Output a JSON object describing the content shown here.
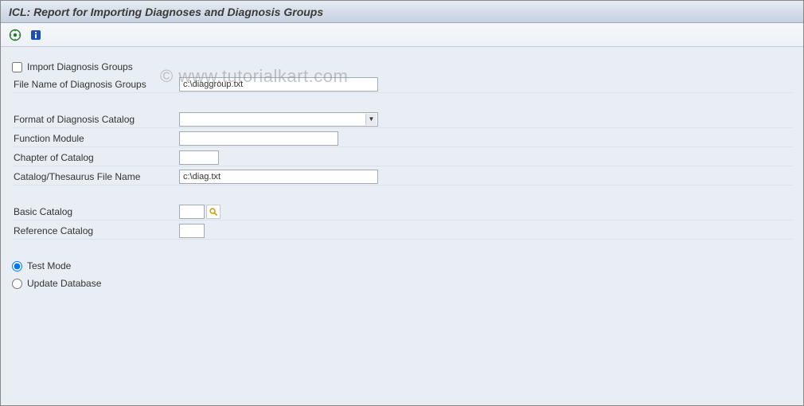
{
  "header": {
    "title": "ICL: Report for Importing Diagnoses and Diagnosis Groups"
  },
  "toolbar": {
    "execute_icon": "execute",
    "info_icon": "info"
  },
  "form": {
    "import_groups": {
      "label": "Import Diagnosis Groups",
      "checked": false
    },
    "file_name_groups": {
      "label": "File Name of Diagnosis Groups",
      "value": "c:\\diaggroup.txt"
    },
    "format_catalog": {
      "label": "Format of Diagnosis Catalog",
      "value": ""
    },
    "function_module": {
      "label": "Function Module",
      "value": ""
    },
    "chapter_catalog": {
      "label": "Chapter of Catalog",
      "value": ""
    },
    "catalog_file_name": {
      "label": "Catalog/Thesaurus File Name",
      "value": "c:\\diag.txt"
    },
    "basic_catalog": {
      "label": "Basic Catalog",
      "value": ""
    },
    "reference_catalog": {
      "label": "Reference Catalog",
      "value": ""
    },
    "mode": {
      "test": "Test Mode",
      "update": "Update Database",
      "selected": "test"
    }
  },
  "watermark": "© www.tutorialkart.com"
}
